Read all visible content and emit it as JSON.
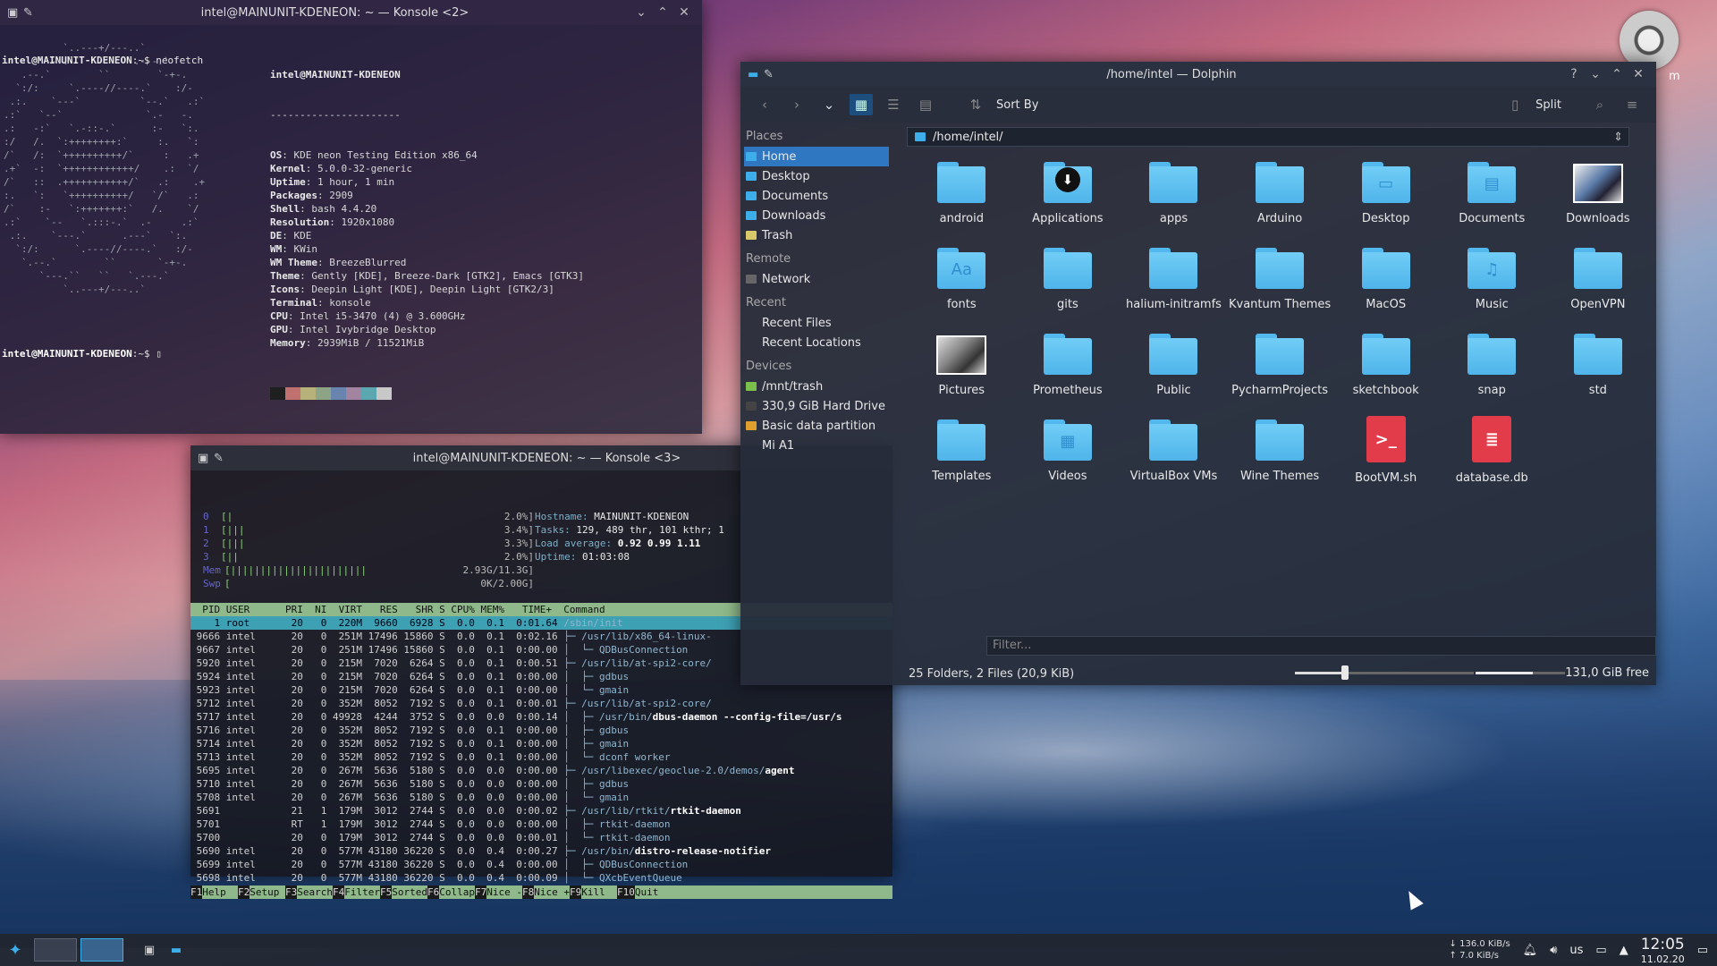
{
  "term1": {
    "title": "intel@MAINUNIT-KDENEON: ~ — Konsole <2>",
    "cmd_prompt": "intel@MAINUNIT-KDENEON",
    "cmd_rest": ":~$ neofetch",
    "header": "intel@MAINUNIT-KDENEON",
    "sep": "----------------------",
    "info": [
      {
        "k": "OS",
        "v": ": KDE neon Testing Edition x86_64"
      },
      {
        "k": "Kernel",
        "v": ": 5.0.0-32-generic"
      },
      {
        "k": "Uptime",
        "v": ": 1 hour, 1 min"
      },
      {
        "k": "Packages",
        "v": ": 2909"
      },
      {
        "k": "Shell",
        "v": ": bash 4.4.20"
      },
      {
        "k": "Resolution",
        "v": ": 1920x1080"
      },
      {
        "k": "DE",
        "v": ": KDE"
      },
      {
        "k": "WM",
        "v": ": KWin"
      },
      {
        "k": "WM Theme",
        "v": ": BreezeBlurred"
      },
      {
        "k": "Theme",
        "v": ": Gently [KDE], Breeze-Dark [GTK2], Emacs [GTK3]"
      },
      {
        "k": "Icons",
        "v": ": Deepin Light [KDE], Deepin Light [GTK2/3]"
      },
      {
        "k": "Terminal",
        "v": ": konsole"
      },
      {
        "k": "CPU",
        "v": ": Intel i5-3470 (4) @ 3.600GHz"
      },
      {
        "k": "GPU",
        "v": ": Intel Ivybridge Desktop"
      },
      {
        "k": "Memory",
        "v": ": 2939MiB / 11521MiB"
      }
    ],
    "swatch_colors": [
      "#1f1f1f",
      "#c0706e",
      "#b6b07a",
      "#8ea486",
      "#6a84b0",
      "#a283a0",
      "#5aa7b0",
      "#c8c8c8"
    ],
    "prompt2": "intel@MAINUNIT-KDENEON",
    "prompt2_rest": ":~$ ▯"
  },
  "term2": {
    "title": "intel@MAINUNIT-KDENEON: ~ — Konsole <3>",
    "cpus": [
      {
        "n": "0",
        "bar": "[|",
        "val": "2.0%]"
      },
      {
        "n": "1",
        "bar": "[|||",
        "val": "3.4%]"
      },
      {
        "n": "2",
        "bar": "[|||",
        "val": "3.3%]"
      },
      {
        "n": "3",
        "bar": "[||",
        "val": "2.0%]"
      }
    ],
    "mem": {
      "lbl": "Mem",
      "bar": "[|||||||||||||||||||||||",
      "val": "2.93G/11.3G]"
    },
    "swp": {
      "lbl": "Swp",
      "bar": "[",
      "val": "0K/2.00G]"
    },
    "hostname_k": "Hostname: ",
    "hostname_v": "MAINUNIT-KDENEON",
    "tasks_k": "Tasks: ",
    "tasks_v": "129, 489 thr, 101 kthr; 1",
    "load_k": "Load average: ",
    "load_v": "0.92 0.99 1.11",
    "uptime_k": "Uptime: ",
    "uptime_v": "01:03:08",
    "header": "  PID USER      PRI  NI  VIRT   RES   SHR S CPU% MEM%   TIME+  Command",
    "rows": [
      {
        "l": "    1 root       20   0  220M  9660  6928 S  0.0  0.1  0:01.64 ",
        "c": "/sbin/init",
        "b": ""
      },
      {
        "l": " 9666 intel      20   0  251M 17496 15860 S  0.0  0.1  0:02.16 ",
        "c": "├─ /usr/lib/x86_64-linux-",
        "b": ""
      },
      {
        "l": " 9667 intel      20   0  251M 17496 15860 S  0.0  0.1  0:00.00 ",
        "c": "│  └─ QDBusConnection",
        "b": ""
      },
      {
        "l": " 5920 intel      20   0  215M  7020  6264 S  0.0  0.1  0:00.51 ",
        "c": "├─ /usr/lib/at-spi2-core/",
        "b": ""
      },
      {
        "l": " 5924 intel      20   0  215M  7020  6264 S  0.0  0.1  0:00.00 ",
        "c": "│  ├─ gdbus",
        "b": ""
      },
      {
        "l": " 5923 intel      20   0  215M  7020  6264 S  0.0  0.1  0:00.00 ",
        "c": "│  └─ gmain",
        "b": ""
      },
      {
        "l": " 5712 intel      20   0  352M  8052  7192 S  0.0  0.1  0:00.01 ",
        "c": "├─ /usr/lib/at-spi2-core/",
        "b": ""
      },
      {
        "l": " 5717 intel      20   0 49928  4244  3752 S  0.0  0.0  0:00.14 ",
        "c": "│  ├─ /usr/bin/",
        "b": "dbus-daemon --config-file=/usr/s"
      },
      {
        "l": " 5716 intel      20   0  352M  8052  7192 S  0.0  0.1  0:00.00 ",
        "c": "│  ├─ gdbus",
        "b": ""
      },
      {
        "l": " 5714 intel      20   0  352M  8052  7192 S  0.0  0.1  0:00.00 ",
        "c": "│  ├─ gmain",
        "b": ""
      },
      {
        "l": " 5713 intel      20   0  352M  8052  7192 S  0.0  0.1  0:00.00 ",
        "c": "│  └─ dconf worker",
        "b": ""
      },
      {
        "l": " 5695 intel      20   0  267M  5636  5180 S  0.0  0.0  0:00.00 ",
        "c": "├─ /usr/libexec/geoclue-2.0/demos/",
        "b": "agent"
      },
      {
        "l": " 5710 intel      20   0  267M  5636  5180 S  0.0  0.0  0:00.00 ",
        "c": "│  ├─ gdbus",
        "b": ""
      },
      {
        "l": " 5708 intel      20   0  267M  5636  5180 S  0.0  0.0  0:00.00 ",
        "c": "│  └─ gmain",
        "b": ""
      },
      {
        "l": " 5691            21   1  179M  3012  2744 S  0.0  0.0  0:00.02 ",
        "c": "├─ /usr/lib/rtkit/",
        "b": "rtkit-daemon"
      },
      {
        "l": " 5701            RT   1  179M  3012  2744 S  0.0  0.0  0:00.00 ",
        "c": "│  ├─ rtkit-daemon",
        "b": ""
      },
      {
        "l": " 5700            20   0  179M  3012  2744 S  0.0  0.0  0:00.01 ",
        "c": "│  └─ rtkit-daemon",
        "b": ""
      },
      {
        "l": " 5690 intel      20   0  577M 43180 36220 S  0.0  0.4  0:00.27 ",
        "c": "├─ /usr/bin/",
        "b": "distro-release-notifier"
      },
      {
        "l": " 5699 intel      20   0  577M 43180 36220 S  0.0  0.4  0:00.00 ",
        "c": "│  ├─ QDBusConnection",
        "b": ""
      },
      {
        "l": " 5698 intel      20   0  577M 43180 36220 S  0.0  0.4  0:00.09 ",
        "c": "│  └─ QXcbEventQueue",
        "b": ""
      }
    ],
    "fkeys": [
      {
        "n": "F1",
        "l": "Help  "
      },
      {
        "n": "F2",
        "l": "Setup "
      },
      {
        "n": "F3",
        "l": "Search"
      },
      {
        "n": "F4",
        "l": "Filter"
      },
      {
        "n": "F5",
        "l": "Sorted"
      },
      {
        "n": "F6",
        "l": "Collap"
      },
      {
        "n": "F7",
        "l": "Nice -"
      },
      {
        "n": "F8",
        "l": "Nice +"
      },
      {
        "n": "F9",
        "l": "Kill  "
      },
      {
        "n": "F10",
        "l": "Quit"
      }
    ]
  },
  "dolphin": {
    "title": "/home/intel — Dolphin",
    "sort_label": "Sort By",
    "split_label": "Split",
    "address": "/home/intel/",
    "sections": {
      "places": "Places",
      "remote": "Remote",
      "recent": "Recent",
      "devices": "Devices"
    },
    "places": [
      "Home",
      "Desktop",
      "Documents",
      "Downloads",
      "Trash"
    ],
    "remote": [
      "Network"
    ],
    "recent": [
      "Recent Files",
      "Recent Locations"
    ],
    "devices": [
      "/mnt/trash",
      "330,9 GiB Hard Drive",
      "Basic data partition",
      "Mi A1"
    ],
    "items": [
      {
        "name": "android",
        "kind": "folder"
      },
      {
        "name": "Applications",
        "kind": "apps"
      },
      {
        "name": "apps",
        "kind": "folder"
      },
      {
        "name": "Arduino",
        "kind": "folder"
      },
      {
        "name": "Desktop",
        "kind": "folder-desktop"
      },
      {
        "name": "Documents",
        "kind": "folder-doc"
      },
      {
        "name": "Downloads",
        "kind": "downloads"
      },
      {
        "name": "fonts",
        "kind": "folder-fonts"
      },
      {
        "name": "gits",
        "kind": "folder"
      },
      {
        "name": "halium-initramfs",
        "kind": "folder"
      },
      {
        "name": "Kvantum Themes",
        "kind": "folder"
      },
      {
        "name": "MacOS",
        "kind": "folder"
      },
      {
        "name": "Music",
        "kind": "folder-music"
      },
      {
        "name": "OpenVPN",
        "kind": "folder"
      },
      {
        "name": "Pictures",
        "kind": "pictures"
      },
      {
        "name": "Prometheus",
        "kind": "folder"
      },
      {
        "name": "Public",
        "kind": "folder"
      },
      {
        "name": "PycharmProjects",
        "kind": "folder"
      },
      {
        "name": "sketchbook",
        "kind": "folder"
      },
      {
        "name": "snap",
        "kind": "folder"
      },
      {
        "name": "std",
        "kind": "folder"
      },
      {
        "name": "Templates",
        "kind": "folder"
      },
      {
        "name": "Videos",
        "kind": "folder-video"
      },
      {
        "name": "VirtualBox VMs",
        "kind": "folder"
      },
      {
        "name": "Wine Themes",
        "kind": "folder"
      },
      {
        "name": "BootVM.sh",
        "kind": "script"
      },
      {
        "name": "database.db",
        "kind": "db"
      }
    ],
    "filter_placeholder": "Filter...",
    "status_text": "25 Folders, 2 Files (20,9 KiB)",
    "zoom_fraction": 0.28,
    "disk_used_fraction": 0.64,
    "free_text": "131,0 GiB free"
  },
  "desktop": {
    "steam_label": "m"
  },
  "taskbar": {
    "net_down": "↓ 136.0 KiB/s",
    "net_up": "↑ 7.0 KiB/s",
    "kbd": "us",
    "time": "12:05",
    "date": "11.02.20"
  }
}
